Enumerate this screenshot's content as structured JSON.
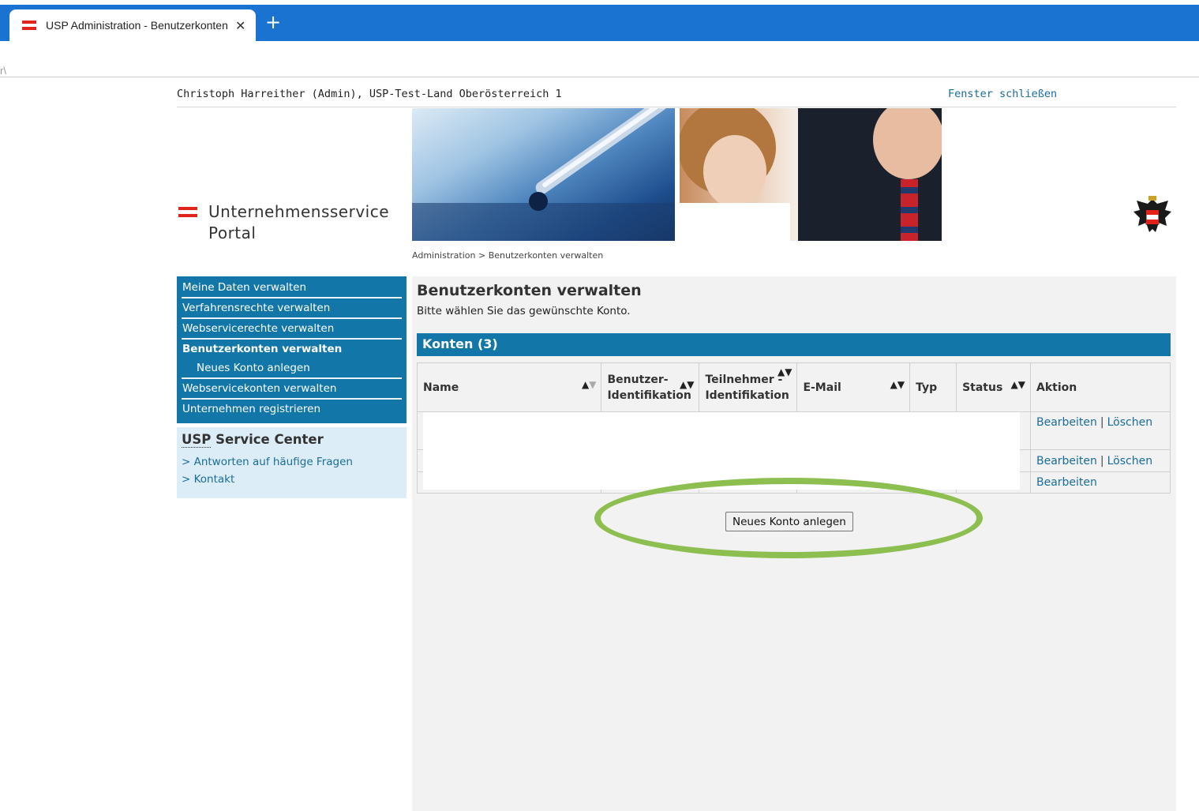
{
  "browser": {
    "tab_title": "USP Administration - Benutzerkonten verwalten",
    "tab_close": "✕",
    "new_tab": "+",
    "toolbar_stub": "r\\"
  },
  "header": {
    "user_line": "Christoph Harreither (Admin), USP-Test-Land Oberösterreich 1",
    "close_window": "Fenster schließen",
    "logo_line1": "Unternehmensservice",
    "logo_line2": "Portal",
    "breadcrumb": "Administration > Benutzerkonten verwalten"
  },
  "nav": {
    "items": [
      {
        "label": "Meine Daten verwalten"
      },
      {
        "label": "Verfahrensrechte verwalten"
      },
      {
        "label": "Webservicerechte verwalten"
      },
      {
        "label": "Benutzerkonten verwalten"
      },
      {
        "label": "Neues Konto anlegen"
      },
      {
        "label": "Webservicekonten verwalten"
      },
      {
        "label": "Unternehmen registrieren"
      }
    ]
  },
  "service_center": {
    "title_abbr": "USP",
    "title_rest": " Service Center",
    "links": [
      {
        "label": "> Antworten auf häufige Fragen"
      },
      {
        "label": "> Kontakt"
      }
    ]
  },
  "main": {
    "title": "Benutzerkonten verwalten",
    "subtitle": "Bitte wählen Sie das gewünschte Konto.",
    "section_title": "Konten (3)",
    "columns": {
      "name": "Name",
      "benutzer_1": "Benutzer-",
      "benutzer_2": "Identifikation",
      "teilnehmer_1": "Teilnehmer -",
      "teilnehmer_2": "Identifikation",
      "email": "E-Mail",
      "typ": "Typ",
      "status": "Status",
      "aktion": "Aktion"
    },
    "sort_glyph": "▲▼",
    "rows": [
      {
        "edit": "Bearbeiten",
        "sep": "|",
        "delete": "Löschen"
      },
      {
        "edit": "Bearbeiten",
        "sep": "|",
        "delete": "Löschen"
      },
      {
        "edit": "Bearbeiten"
      }
    ],
    "new_account_button": "Neues Konto anlegen"
  },
  "colors": {
    "brand_blue": "#1277a8",
    "tabbar_blue": "#1a73d1",
    "highlight_green": "#8cbf50",
    "austria_red": "#e2231a"
  }
}
